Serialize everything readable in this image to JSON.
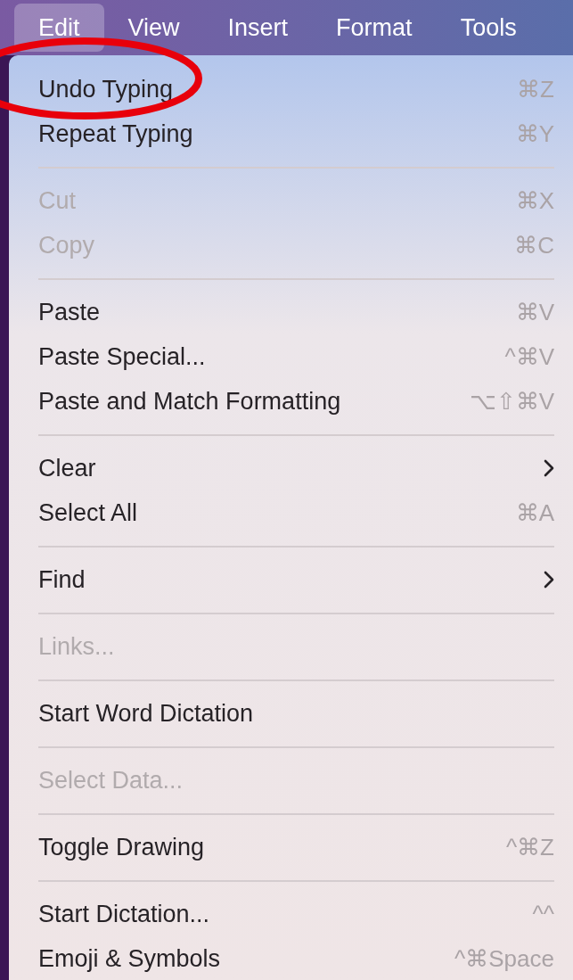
{
  "menu_bar": [
    {
      "label": "Edit",
      "selected": true
    },
    {
      "label": "View",
      "selected": false
    },
    {
      "label": "Insert",
      "selected": false
    },
    {
      "label": "Format",
      "selected": false
    },
    {
      "label": "Tools",
      "selected": false
    }
  ],
  "menu": {
    "groups": [
      [
        {
          "kind": "shortcut",
          "label": "Undo Typing",
          "shortcut": "⌘Z",
          "disabled": false
        },
        {
          "kind": "shortcut",
          "label": "Repeat Typing",
          "shortcut": "⌘Y",
          "disabled": false
        }
      ],
      [
        {
          "kind": "shortcut",
          "label": "Cut",
          "shortcut": "⌘X",
          "disabled": true
        },
        {
          "kind": "shortcut",
          "label": "Copy",
          "shortcut": "⌘C",
          "disabled": true
        }
      ],
      [
        {
          "kind": "shortcut",
          "label": "Paste",
          "shortcut": "⌘V",
          "disabled": false
        },
        {
          "kind": "shortcut",
          "label": "Paste Special...",
          "shortcut": "^⌘V",
          "disabled": false
        },
        {
          "kind": "shortcut",
          "label": "Paste and Match Formatting",
          "shortcut": "⌥⇧⌘V",
          "disabled": false
        }
      ],
      [
        {
          "kind": "submenu",
          "label": "Clear",
          "disabled": false
        },
        {
          "kind": "shortcut",
          "label": "Select All",
          "shortcut": "⌘A",
          "disabled": false
        }
      ],
      [
        {
          "kind": "submenu",
          "label": "Find",
          "disabled": false
        }
      ],
      [
        {
          "kind": "plain",
          "label": "Links...",
          "disabled": true
        }
      ],
      [
        {
          "kind": "plain",
          "label": "Start Word Dictation",
          "disabled": false
        }
      ],
      [
        {
          "kind": "plain",
          "label": "Select Data...",
          "disabled": true
        }
      ],
      [
        {
          "kind": "shortcut",
          "label": "Toggle Drawing",
          "shortcut": "^⌘Z",
          "disabled": false
        }
      ],
      [
        {
          "kind": "shortcut",
          "label": "Start Dictation...",
          "shortcut": "^^",
          "disabled": false
        },
        {
          "kind": "shortcut",
          "label": "Emoji & Symbols",
          "shortcut": "^⌘Space",
          "disabled": false
        }
      ]
    ]
  }
}
